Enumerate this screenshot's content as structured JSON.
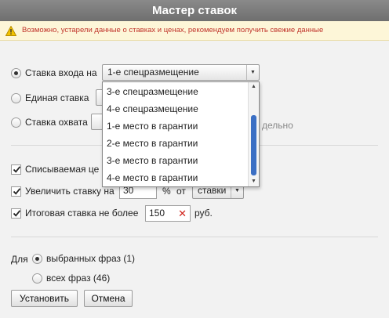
{
  "window": {
    "title": "Мастер ставок"
  },
  "warning": {
    "text": "Возможно, устарели данные о ставках и ценах, рекомендуем получить свежие данные"
  },
  "bid_type": {
    "entry_label": "Ставка входа на",
    "entry_value": "1-е спецразмещение",
    "single_label": "Единая ставка",
    "coverage_label": "Ставка охвата",
    "coverage_suffix_partial": "дельно",
    "options": [
      "3-е спецразмещение",
      "4-е спецразмещение",
      "1-е место в гарантии",
      "2-е место в гарантии",
      "3-е место в гарантии",
      "4-е место в гарантии"
    ]
  },
  "options": {
    "debit_label_partial": "Списываемая це",
    "increase_label": "Увеличить ставку на",
    "increase_value": "30",
    "percent_sign": "%",
    "from_label": "от",
    "from_select_value": "ставки",
    "max_label": "Итоговая ставка не более",
    "max_value": "150",
    "currency": "руб."
  },
  "scope": {
    "for_label": "Для",
    "selected_label": "выбранных фраз (1)",
    "all_label": "всех фраз (46)"
  },
  "buttons": {
    "apply": "Установить",
    "cancel": "Отмена"
  },
  "colors": {
    "title_bg": "#7a7a7a",
    "warning_text": "#c0342b",
    "scroll_thumb": "#3b6fc4"
  }
}
